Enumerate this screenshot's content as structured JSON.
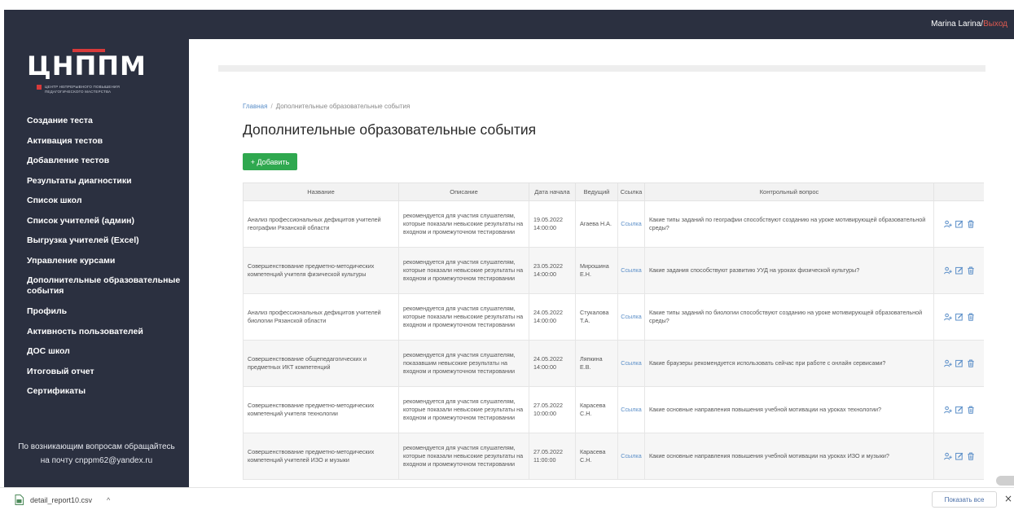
{
  "header": {
    "user_name": "Marina Larina",
    "separator": "/",
    "logout_label": "Выход"
  },
  "logo": {
    "text": "ЦНППМ",
    "subtitle_line1": "ЦЕНТР НЕПРЕРЫВНОГО ПОВЫШЕНИЯ",
    "subtitle_line2": "ПЕДАГОГИЧЕСКОГО МАСТЕРСТВА"
  },
  "sidebar": {
    "items": [
      {
        "label": "Создание теста"
      },
      {
        "label": "Активация тестов"
      },
      {
        "label": "Добавление тестов"
      },
      {
        "label": "Результаты диагностики"
      },
      {
        "label": "Список школ"
      },
      {
        "label": "Список учителей (админ)"
      },
      {
        "label": "Выгрузка учителей (Excel)"
      },
      {
        "label": "Управление курсами"
      },
      {
        "label": "Дополнительные образовательные события"
      },
      {
        "label": "Профиль"
      },
      {
        "label": "Активность пользователей"
      },
      {
        "label": "ДОС школ"
      },
      {
        "label": "Итоговый отчет"
      },
      {
        "label": "Сертификаты"
      }
    ],
    "contact_line1": "По возникающим вопросам обращайтесь",
    "contact_line2": "на почту cnppm62@yandex.ru"
  },
  "breadcrumb": {
    "home": "Главная",
    "separator": "/",
    "current": "Дополнительные образовательные события"
  },
  "page": {
    "title": "Дополнительные образовательные события",
    "add_button": "+ Добавить"
  },
  "table": {
    "headers": [
      "Название",
      "Описание",
      "Дата начала",
      "Ведущий",
      "Ссылка",
      "Контрольный вопрос",
      ""
    ],
    "rows": [
      {
        "name": "Анализ профессиональных дефицитов учителей географии Рязанской области",
        "description": "рекомендуется для участия слушателям, которые показали невысокие результаты на входном и промежуточном тестировании",
        "date": "19.05.2022 14:00:00",
        "host": "Агаева Н.А.",
        "link": "Ссылка",
        "question": "Какие типы заданий по географии способствуют созданию на уроке мотивирующей образовательной среды?"
      },
      {
        "name": "Совершенствование предметно-методических компетенций учителя физической культуры",
        "description": "рекомендуется для участия слушателям, которые показали невысокие результаты на входном и промежуточном тестировании",
        "date": "23.05.2022 14:00:00",
        "host": "Мирошина Е.Н.",
        "link": "Ссылка",
        "question": "Какие задания способствуют развитию УУД на уроках физической культуры?"
      },
      {
        "name": "Анализ профессиональных дефицитов учителей биологии Рязанской области",
        "description": "рекомендуется для участия слушателям, которые показали невысокие результаты на входном и промежуточном тестировании",
        "date": "24.05.2022 14:00:00",
        "host": "Стукалова Т.А.",
        "link": "Ссылка",
        "question": "Какие типы заданий по биологии способствуют созданию на уроке мотивирующей образовательной среды?"
      },
      {
        "name": "Совершенствование общепедагогических и предметных ИКТ компетенций",
        "description": "рекомендуется для участия слушателям, показавшим невысокие результаты на входном и промежуточном тестировании",
        "date": "24.05.2022 14:00:00",
        "host": "Ляпкина Е.В.",
        "link": "Ссылка",
        "question": "Какие браузеры рекомендуется использовать сейчас при работе с онлайн сервисами?"
      },
      {
        "name": "Совершенствование предметно-методических компетенций учителя технологии",
        "description": "рекомендуется для участия слушателям, которые показали невысокие результаты на входном и промежуточном тестировании",
        "date": "27.05.2022 10:00:00",
        "host": "Карасева С.Н.",
        "link": "Ссылка",
        "question": "Какие основные направления повышения учебной мотивации на уроках технологии?"
      },
      {
        "name": "Совершенствование предметно-методических компетенций учителей ИЗО и музыки",
        "description": "рекомендуется для участия слушателям, которые показали невысокие результаты на входном и промежуточном тестировании",
        "date": "27.05.2022 11:00:00",
        "host": "Карасева С.Н.",
        "link": "Ссылка",
        "question": "Какие основные направления повышения учебной мотивации на уроках ИЗО и музыки?"
      }
    ]
  },
  "download_bar": {
    "file_name": "detail_report10.csv",
    "chevron": "^",
    "show_all": "Показать все",
    "close": "×"
  },
  "colors": {
    "sidebar_bg": "#2b3040",
    "accent_green": "#2fa84f",
    "link_blue": "#5a8ec8",
    "logo_red": "#d83a3a"
  }
}
